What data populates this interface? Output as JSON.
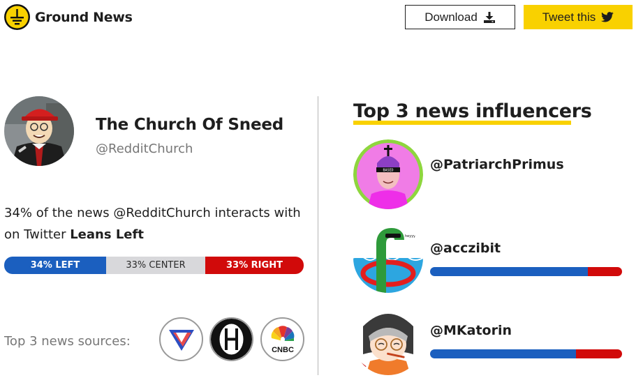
{
  "header": {
    "brand": "Ground News",
    "download_label": "Download",
    "tweet_label": "Tweet this"
  },
  "profile": {
    "name": "The Church Of Sneed",
    "handle": "@RedditChurch"
  },
  "bias": {
    "text_prefix": "34% of the news @RedditChurch interacts with on Twitter ",
    "lean": "Leans Left",
    "left_label": "34% LEFT",
    "center_label": "33% CENTER",
    "right_label": "33% RIGHT",
    "left_pct": 34,
    "center_pct": 33,
    "right_pct": 33
  },
  "sources": {
    "label": "Top 3 news sources:",
    "items": [
      {
        "icon": "verge-logo"
      },
      {
        "icon": "hill-logo"
      },
      {
        "icon": "cnbc-logo",
        "text": "CNBC"
      }
    ]
  },
  "influencers": {
    "title": "Top 3 news influencers",
    "items": [
      {
        "handle": "@PatriarchPrimus",
        "avatar_text": "BASED"
      },
      {
        "handle": "@acczibit",
        "avatar_text": "heyyy",
        "left_fraction": 0.82
      },
      {
        "handle": "@MKatorin",
        "left_fraction": 0.76
      }
    ]
  },
  "colors": {
    "accent_yellow": "#f9d100",
    "left_blue": "#1b5fbf",
    "right_red": "#d10a0a",
    "center_gray": "#d8d8db"
  }
}
